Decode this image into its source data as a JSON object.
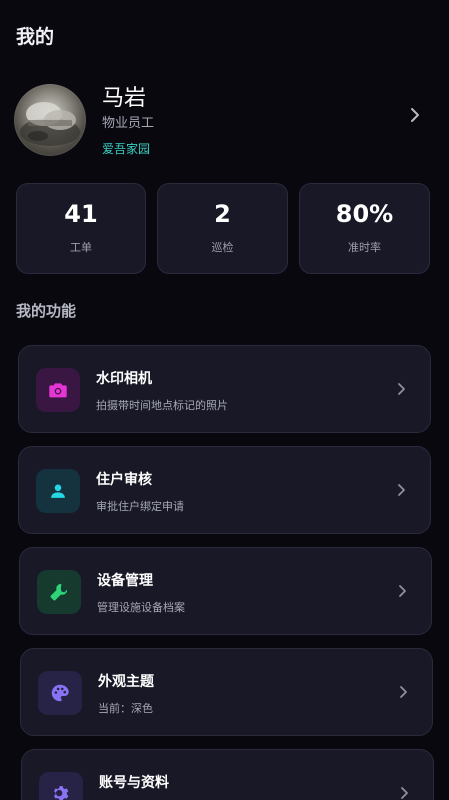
{
  "header": {
    "title": "我的"
  },
  "profile": {
    "name": "马岩",
    "role": "物业员工",
    "community": "爱吾家园"
  },
  "stats": [
    {
      "value": "41",
      "label": "工单"
    },
    {
      "value": "2",
      "label": "巡检"
    },
    {
      "value": "80%",
      "label": "准时率"
    }
  ],
  "features_section": {
    "title": "我的功能"
  },
  "features": [
    {
      "title": "水印相机",
      "desc": "拍摄带时间地点标记的照片",
      "icon": "camera-icon",
      "color": "#e535d4",
      "bg": "#3a1643"
    },
    {
      "title": "住户审核",
      "desc": "审批住户绑定申请",
      "icon": "person-icon",
      "color": "#25d6e3",
      "bg": "#15333f"
    },
    {
      "title": "设备管理",
      "desc": "管理设施设备档案",
      "icon": "wrench-icon",
      "color": "#2ed47a",
      "bg": "#163a2e"
    },
    {
      "title": "外观主题",
      "desc": "当前：深色",
      "icon": "palette-icon",
      "color": "#8a73f2",
      "bg": "#262346"
    },
    {
      "title": "账号与资料",
      "desc": "",
      "icon": "gear-icon",
      "color": "#8a73f2",
      "bg": "#262346"
    }
  ]
}
